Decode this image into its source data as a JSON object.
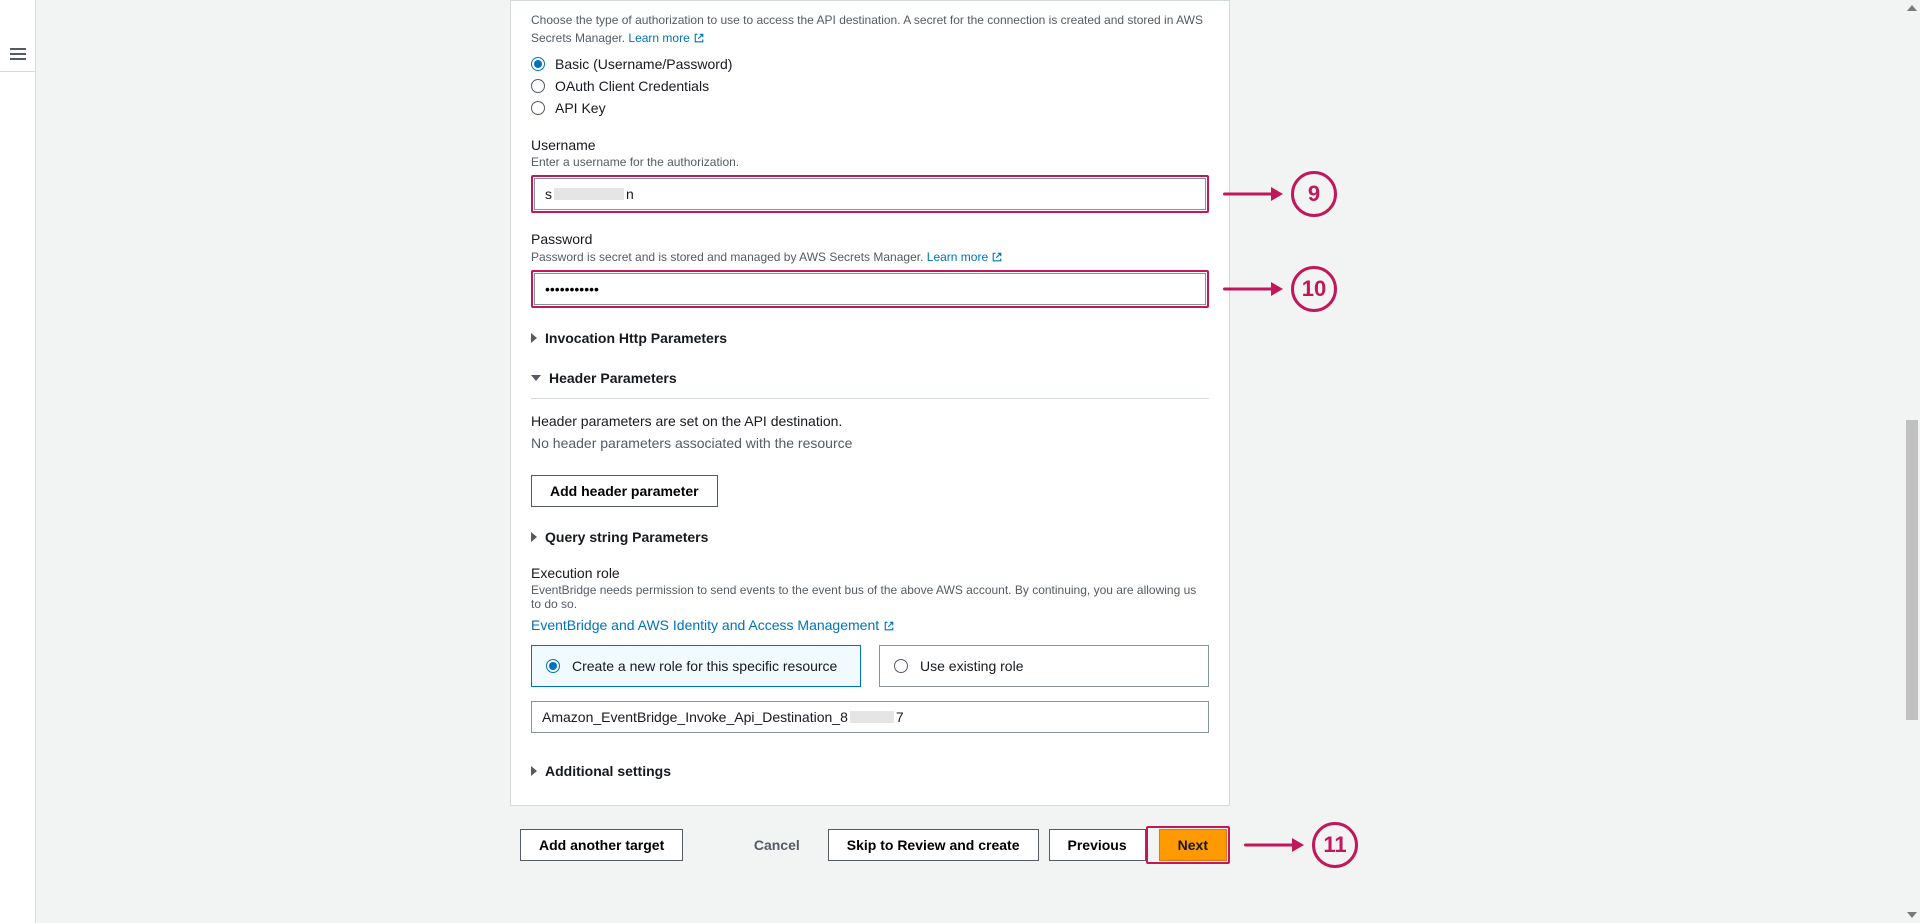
{
  "authorization": {
    "description_prefix": "Choose the type of authorization to use to access the API destination. A secret for the connection is created and stored in AWS Secrets Manager. ",
    "learn_more": "Learn more",
    "options": {
      "basic": "Basic (Username/Password)",
      "oauth": "OAuth Client Credentials",
      "apikey": "API Key"
    }
  },
  "username": {
    "label": "Username",
    "hint": "Enter a username for the authorization.",
    "value_prefix": "s",
    "value_suffix": "n"
  },
  "password": {
    "label": "Password",
    "hint_prefix": "Password is secret and is stored and managed by AWS Secrets Manager. ",
    "learn_more": "Learn more",
    "value": "•••••••••••"
  },
  "invocation": {
    "title": "Invocation Http Parameters"
  },
  "headers": {
    "title": "Header Parameters",
    "desc": "Header parameters are set on the API destination.",
    "empty": "No header parameters associated with the resource",
    "add_btn": "Add header parameter"
  },
  "query": {
    "title": "Query string Parameters"
  },
  "execution_role": {
    "label": "Execution role",
    "hint": "EventBridge needs permission to send events to the event bus of the above AWS account. By continuing, you are allowing us to do so.",
    "iam_link": "EventBridge and AWS Identity and Access Management",
    "create_new": "Create a new role for this specific resource",
    "use_existing": "Use existing role",
    "role_name_prefix": "Amazon_EventBridge_Invoke_Api_Destination_8",
    "role_name_suffix": "7"
  },
  "additional": {
    "title": "Additional settings"
  },
  "footer": {
    "add_another": "Add another target",
    "cancel": "Cancel",
    "skip": "Skip to Review and create",
    "previous": "Previous",
    "next": "Next"
  },
  "callouts": {
    "c9": "9",
    "c10": "10",
    "c11": "11"
  }
}
